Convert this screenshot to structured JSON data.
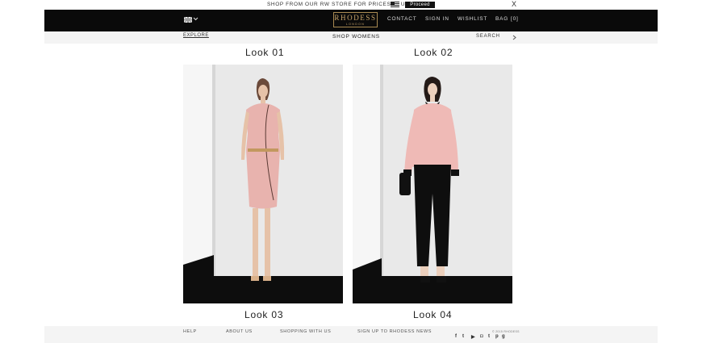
{
  "banner": {
    "text": "SHOP FROM OUR RW STORE FOR PRICES IN USD",
    "proceed_label": "Proceed",
    "close_label": "X"
  },
  "header": {
    "logo_main": "RHODESS",
    "logo_sub": "LONDON",
    "nav": [
      {
        "label": "CONTACT"
      },
      {
        "label": "SIGN IN"
      },
      {
        "label": "WISHLIST"
      },
      {
        "label": "BAG"
      }
    ],
    "bag_count": "[0]"
  },
  "subnav": {
    "explore": "EXPLORE",
    "shop_womens": "SHOP WOMENS",
    "search": "SEARCH"
  },
  "looks": [
    {
      "title": "Look 01"
    },
    {
      "title": "Look 02"
    },
    {
      "title": "Look 03"
    },
    {
      "title": "Look 04"
    }
  ],
  "footer": {
    "links": [
      {
        "label": "HELP"
      },
      {
        "label": "ABOUT US"
      },
      {
        "label": "SHOPPING WITH US"
      },
      {
        "label": "SIGN UP TO RHODESS NEWS"
      }
    ],
    "copyright": "© 2015 RHODESS",
    "social_icons": [
      "facebook-icon",
      "twitter-icon",
      "youtube-icon",
      "instagram-icon",
      "tumblr-icon",
      "pinterest-icon",
      "google-plus-icon"
    ]
  },
  "colors": {
    "nav_bg": "#0a0a0a",
    "logo_gold": "#c9a56a",
    "accent_pink": "#e8b3ae",
    "footer_bg": "#f4f4f4"
  }
}
